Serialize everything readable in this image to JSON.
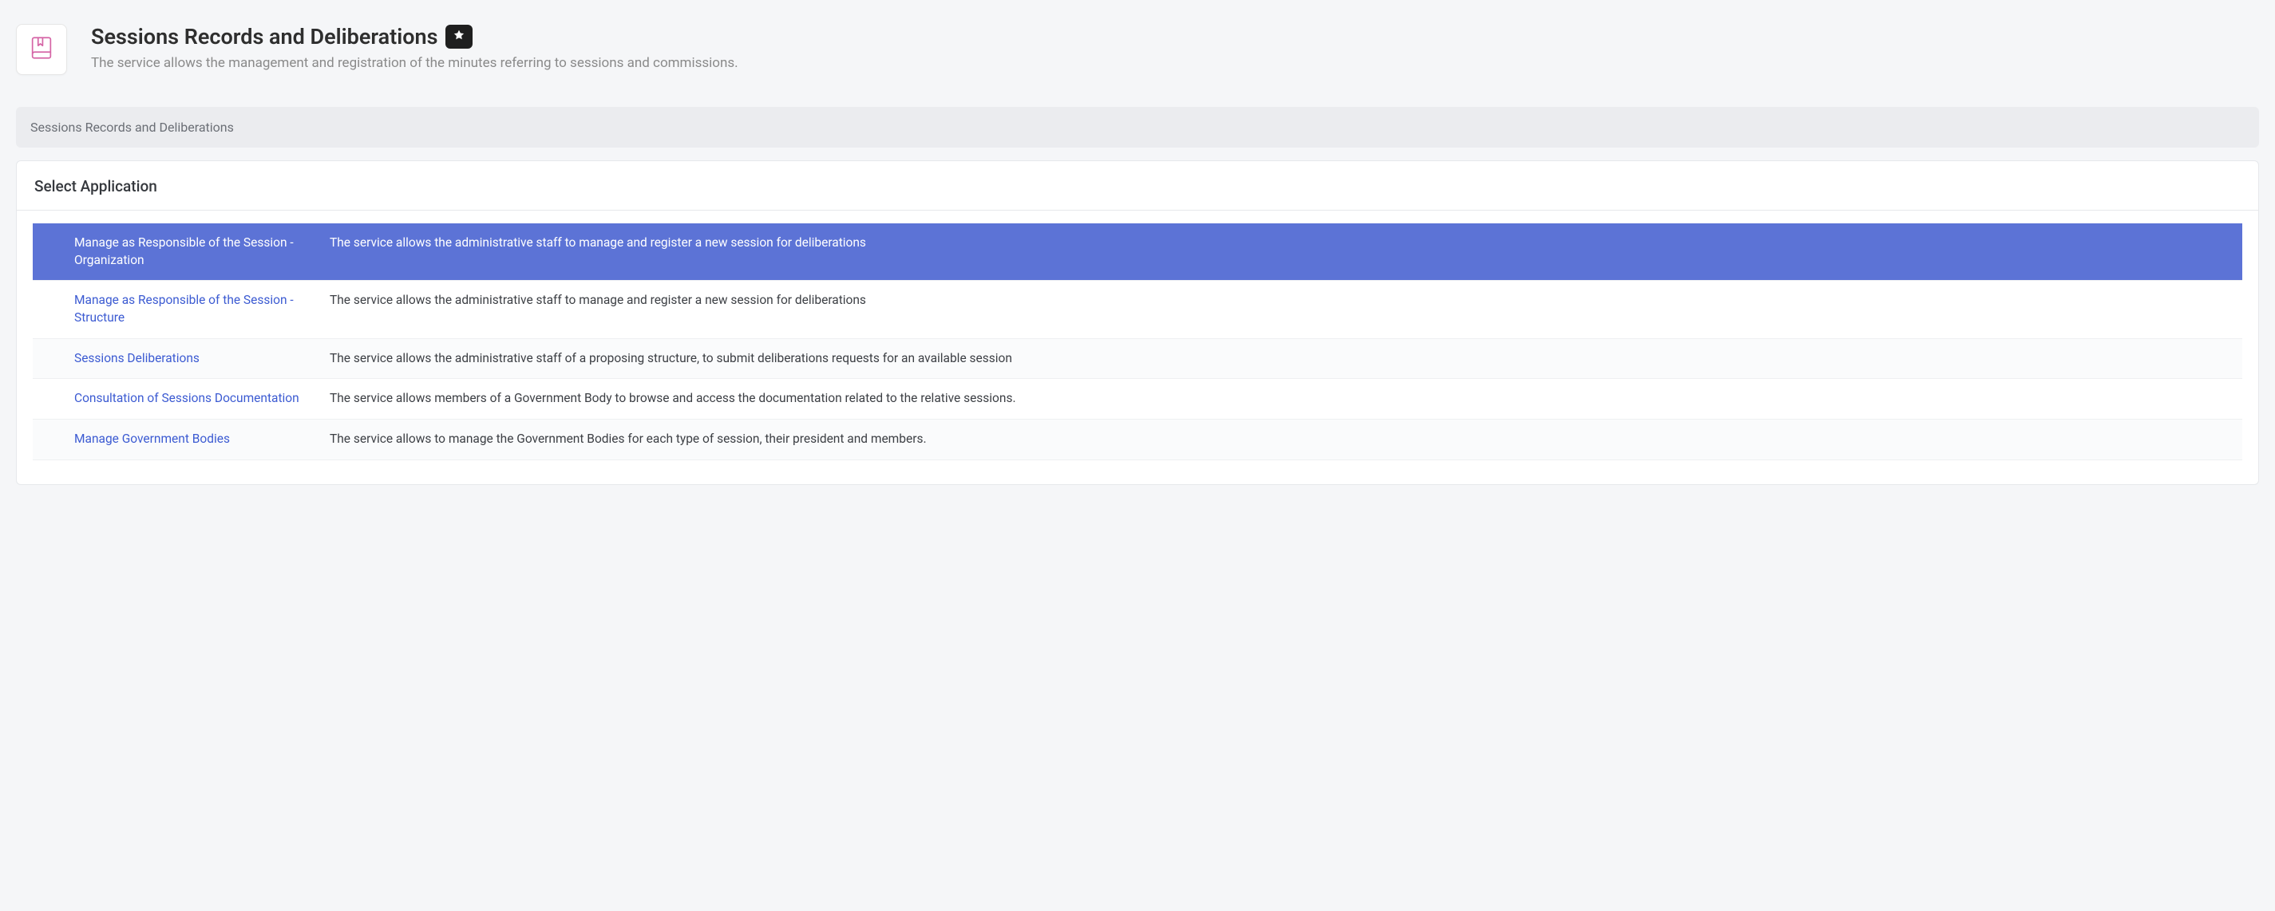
{
  "header": {
    "title": "Sessions Records and Deliberations",
    "subtitle": "The service allows the management and registration of the minutes referring to sessions and commissions."
  },
  "breadcrumb": "Sessions Records and Deliberations",
  "card": {
    "title": "Select Application"
  },
  "applications": [
    {
      "name": "Manage as Responsible of the Session - Organization",
      "description": "The service allows the administrative staff to manage and register a new session for deliberations",
      "selected": true
    },
    {
      "name": "Manage as Responsible of the Session - Structure",
      "description": "The service allows the administrative staff to manage and register a new session for deliberations",
      "selected": false
    },
    {
      "name": "Sessions Deliberations",
      "description": "The service allows the administrative staff of a proposing structure, to submit deliberations requests for an available session",
      "selected": false
    },
    {
      "name": "Consultation of Sessions Documentation",
      "description": "The service allows members of a Government Body to browse and access the documentation related to the relative sessions.",
      "selected": false
    },
    {
      "name": "Manage Government Bodies",
      "description": "The service allows to manage the Government Bodies for each type of session, their president and members.",
      "selected": false
    }
  ]
}
